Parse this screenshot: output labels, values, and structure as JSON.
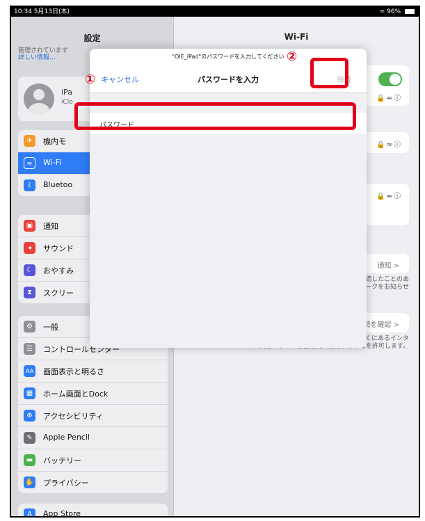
{
  "status": {
    "time": "10:34  5月13日(木)",
    "battery": "96%"
  },
  "sidebar": {
    "title": "設定",
    "managed_line1": "管理されています",
    "managed_line2": "詳しい情報...",
    "profile_name": "iPa",
    "profile_sub": "iClo",
    "group1": [
      {
        "icon": "airplane-icon",
        "label": "機内モ",
        "color": "#f29a2b"
      },
      {
        "icon": "wifi-icon",
        "label": "Wi-Fi",
        "color": "#2f7df6",
        "selected": true
      },
      {
        "icon": "bluetooth-icon",
        "label": "Bluetoo",
        "color": "#2f7df6"
      }
    ],
    "group2": [
      {
        "icon": "notifications-icon",
        "label": "通知",
        "color": "#e8413c"
      },
      {
        "icon": "sound-icon",
        "label": "サウンド",
        "color": "#e8413c"
      },
      {
        "icon": "moon-icon",
        "label": "おやすみ",
        "color": "#5a55d6"
      },
      {
        "icon": "hourglass-icon",
        "label": "スクリー",
        "color": "#5a55d6"
      }
    ],
    "group3": [
      {
        "icon": "gear-icon",
        "label": "一般",
        "color": "#8e8e93"
      },
      {
        "icon": "control-center-icon",
        "label": "コントロールセンター",
        "color": "#8e8e93"
      },
      {
        "icon": "display-icon",
        "label": "画面表示と明るさ",
        "color": "#2f7df6"
      },
      {
        "icon": "home-screen-icon",
        "label": "ホーム画面とDock",
        "color": "#2f7df6"
      },
      {
        "icon": "accessibility-icon",
        "label": "アクセシビリティ",
        "color": "#2f7df6"
      },
      {
        "icon": "pencil-icon",
        "label": "Apple Pencil",
        "color": "#6d6d72"
      },
      {
        "icon": "battery-icon",
        "label": "バッテリー",
        "color": "#4fb150"
      },
      {
        "icon": "hand-icon",
        "label": "プライバシー",
        "color": "#2f7df6"
      }
    ],
    "group4": [
      {
        "icon": "app-store-icon",
        "label": "App Store",
        "color": "#2f7df6"
      }
    ]
  },
  "detail": {
    "title": "Wi-Fi",
    "notify_label": "通知 >",
    "notify_desc1": "接続したことのあ",
    "notify_desc2": "ークをお知らせ",
    "confirm_label": "接続を確認 >",
    "footer_line1": "くにあるインタ",
    "footer_line2": "ーネット共有スポットを自動的に検出することを許可します。"
  },
  "modal": {
    "prompt": "\"OIE_iPad\"のパスワードを入力してください",
    "cancel": "キャンセル",
    "title": "パスワードを入力",
    "connect": "接続",
    "password_label": "パスワード"
  },
  "annotations": {
    "step1": "①",
    "step2": "②",
    "color": "#e3001b"
  }
}
